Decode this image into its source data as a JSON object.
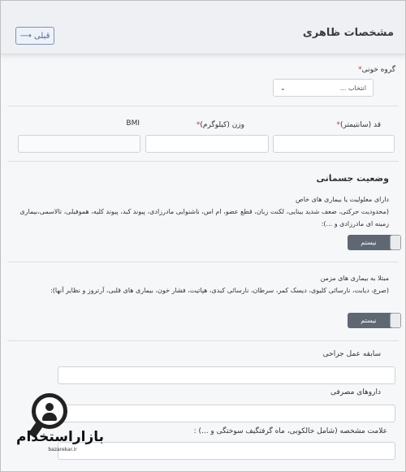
{
  "header": {
    "title": "مشخصات ظاهری",
    "back_label": "قبلی",
    "back_icon": "arrow-right-icon"
  },
  "blood_group": {
    "label": "گروه خونی",
    "required_mark": "*",
    "selected": "انتخاب ...",
    "icon": "chevron-down-icon"
  },
  "measurements": {
    "height_label": "قد (سانتیمتر)",
    "height_required": "*",
    "weight_label": "وزن (کیلوگرم)",
    "weight_required": "*",
    "bmi_label": "BMI"
  },
  "physical_status": {
    "title": "وضعیت جسمانی",
    "disability": {
      "heading": "دارای معلولیت یا بیماری های خاص",
      "description": "(محدودیت حرکتی، ضعف شدید بینایی، لکنت زبان، قطع عضو، ام اس، ناشنوایی مادرزادی، پیوند کبد، پیوند کلیه، هموفیلی، تالاسمی،بیماری زمینه ای مادرزادی و ...):",
      "toggle_label": "نیستم"
    },
    "chronic": {
      "heading": "مبتلا به بیماری های مزمن",
      "description": "(صرع، دیابت، نارسائی کلیوی، دیسک کمر، سرطان، نارسائی کبدی، هپاتیت، فشار خون، بیماری های قلبی، آرتروز و نظایر آنها):",
      "toggle_label": "نیستم"
    }
  },
  "surgery": {
    "label": "سابقه عمل جراحی"
  },
  "medications": {
    "label": "داروهای مصرفی"
  },
  "distinctive_mark": {
    "label": "علامت مشخصه (شامل خالکوبی، ماه گرفتگیف سوختگی و ...) :"
  },
  "watermark": {
    "logo_text": "بازاراستخدام",
    "sub_text": "bazarekar.ir"
  }
}
